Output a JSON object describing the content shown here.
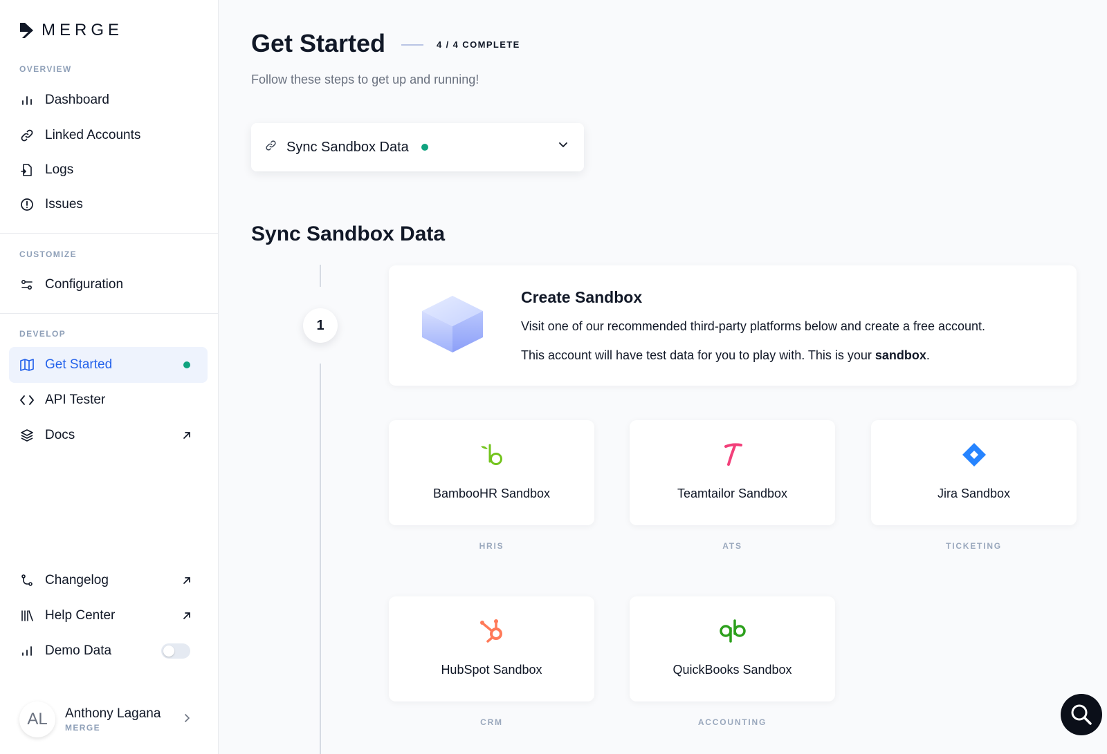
{
  "brand": {
    "name": "MERGE"
  },
  "sidebar": {
    "sections": {
      "overview": "OVERVIEW",
      "customize": "CUSTOMIZE",
      "develop": "DEVELOP"
    },
    "overview_items": [
      {
        "label": "Dashboard",
        "icon": "bar-chart-icon"
      },
      {
        "label": "Linked Accounts",
        "icon": "link-icon"
      },
      {
        "label": "Logs",
        "icon": "logs-icon"
      },
      {
        "label": "Issues",
        "icon": "alert-circle-icon"
      }
    ],
    "customize_items": [
      {
        "label": "Configuration",
        "icon": "sliders-icon"
      }
    ],
    "develop_items": [
      {
        "label": "Get Started",
        "icon": "map-icon",
        "active": true
      },
      {
        "label": "API Tester",
        "icon": "code-icon"
      },
      {
        "label": "Docs",
        "icon": "layers-icon",
        "external": true
      }
    ],
    "footer_items": [
      {
        "label": "Changelog",
        "icon": "git-branch-icon",
        "external": true
      },
      {
        "label": "Help Center",
        "icon": "library-icon",
        "external": true
      },
      {
        "label": "Demo Data",
        "icon": "bar-chart-icon",
        "toggle": false
      }
    ],
    "user": {
      "initials": "AL",
      "name": "Anthony Lagana",
      "org": "MERGE"
    }
  },
  "main": {
    "title": "Get Started",
    "progress": "4 / 4 COMPLETE",
    "subtitle": "Follow these steps to get up and running!",
    "step_select": {
      "label": "Sync Sandbox Data",
      "status_color": "#10a37f"
    },
    "section_title": "Sync Sandbox Data",
    "step": {
      "number": "1",
      "title": "Create Sandbox",
      "desc1": "Visit one of our recommended third-party platforms below and create a free account.",
      "desc2_prefix": "This account will have test data for you to play with. This is your ",
      "desc2_bold": "sandbox",
      "desc2_suffix": "."
    },
    "sandboxes": [
      {
        "name": "BambooHR Sandbox",
        "category": "HRIS",
        "icon": "bamboohr-logo-icon",
        "color": "#73c41d"
      },
      {
        "name": "Teamtailor Sandbox",
        "category": "ATS",
        "icon": "teamtailor-logo-icon",
        "color": "#f2407a"
      },
      {
        "name": "Jira Sandbox",
        "category": "TICKETING",
        "icon": "jira-logo-icon",
        "color": "#2684ff"
      },
      {
        "name": "HubSpot Sandbox",
        "category": "CRM",
        "icon": "hubspot-logo-icon",
        "color": "#ff7a59"
      },
      {
        "name": "QuickBooks Sandbox",
        "category": "ACCOUNTING",
        "icon": "quickbooks-logo-icon",
        "color": "#2ca01c"
      }
    ]
  },
  "colors": {
    "accent": "#2563eb",
    "success": "#10a37f"
  }
}
